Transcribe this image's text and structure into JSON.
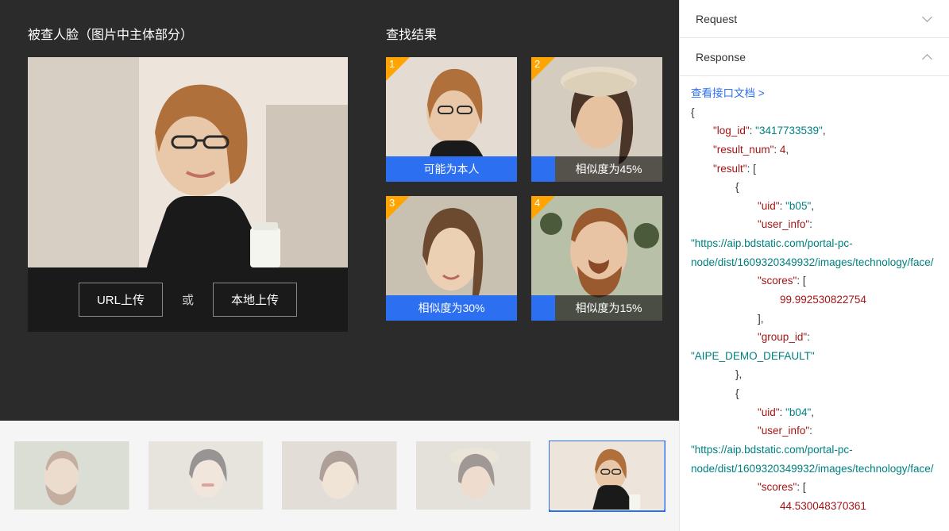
{
  "source": {
    "title": "被查人脸（图片中主体部分）",
    "url_upload": "URL上传",
    "or": "或",
    "local_upload": "本地上传"
  },
  "results": {
    "title": "查找结果",
    "items": [
      {
        "rank": "1",
        "label": "可能为本人",
        "style": "blue"
      },
      {
        "rank": "2",
        "label": "相似度为45%",
        "style": "split"
      },
      {
        "rank": "3",
        "label": "相似度为30%",
        "style": "blue"
      },
      {
        "rank": "4",
        "label": "相似度为15%",
        "style": "split"
      }
    ]
  },
  "thumbs": {
    "selected_index": 4
  },
  "panel": {
    "request_title": "Request",
    "response_title": "Response",
    "doc_link": "查看接口文档 >"
  },
  "response_json": {
    "log_id": "3417733539",
    "result_num": 4,
    "result": [
      {
        "uid": "b05",
        "user_info": "https://aip.bdstatic.com/portal-pc-node/dist/1609320349932/images/technology/face/",
        "scores": [
          99.992530822754
        ],
        "group_id": "AIPE_DEMO_DEFAULT"
      },
      {
        "uid": "b04",
        "user_info": "https://aip.bdstatic.com/portal-pc-node/dist/1609320349932/images/technology/face/",
        "scores": [
          44.530048370361
        ]
      }
    ]
  },
  "colors": {
    "accent": "#2d6ff1",
    "rank_triangle": "#ffa400"
  }
}
